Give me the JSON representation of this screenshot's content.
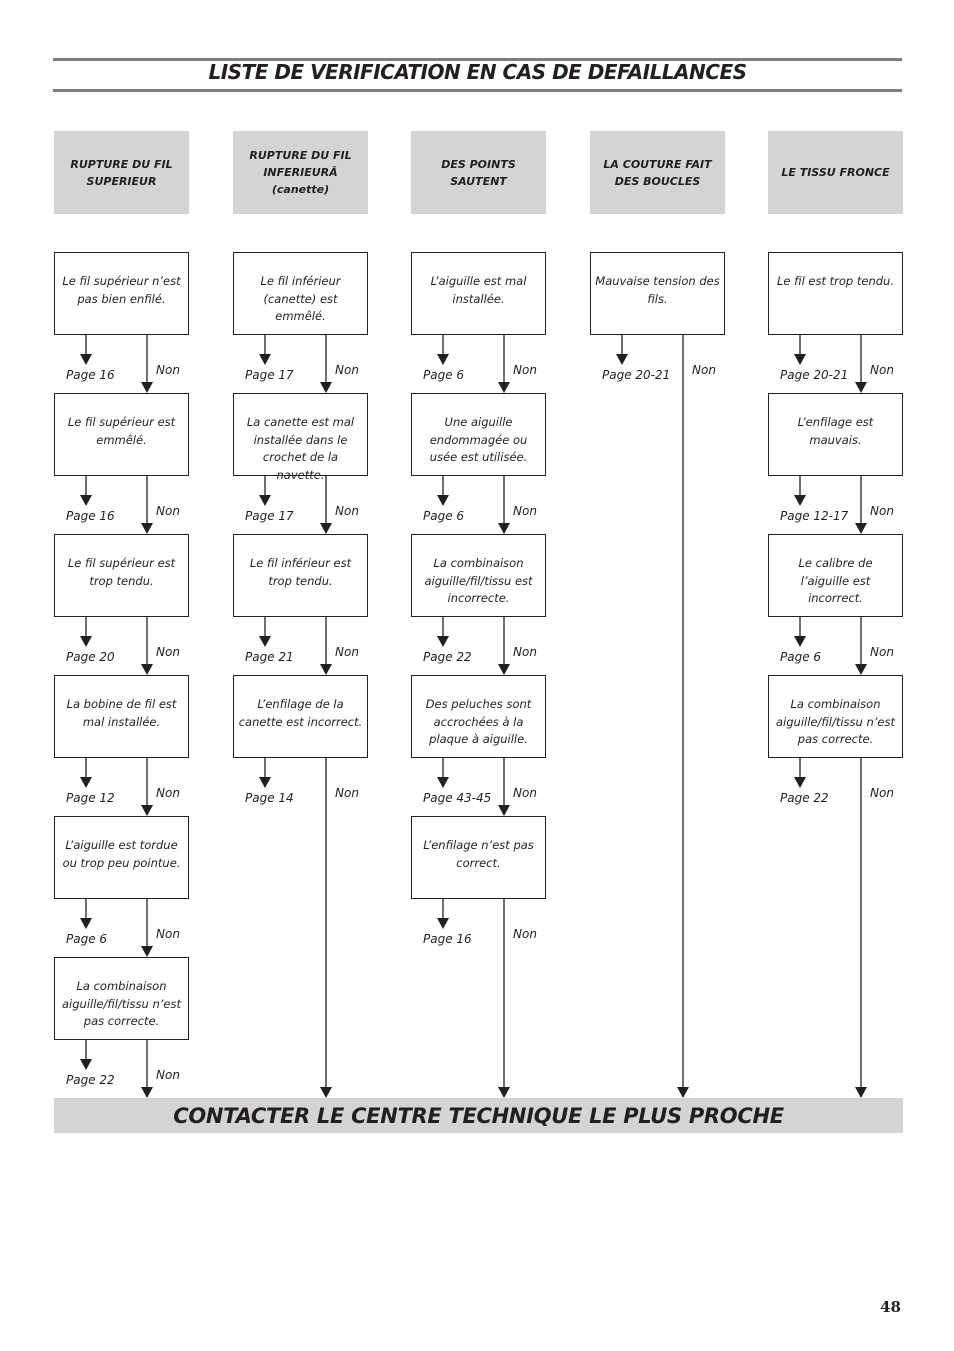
{
  "title": "LISTE DE VERIFICATION EN CAS DE DEFAILLANCES",
  "no_label": "Non",
  "columns": [
    {
      "header": "RUPTURE DU FIL SUPERIEUR",
      "steps": [
        {
          "text": "Le fil supérieur n’est pas bien enfilé.",
          "page": "Page 16"
        },
        {
          "text": "Le fil supérieur est emmêlé.",
          "page": "Page 16"
        },
        {
          "text": "Le fil supérieur est trop tendu.",
          "page": "Page 20"
        },
        {
          "text": "La bobine de fil est mal installée.",
          "page": "Page 12"
        },
        {
          "text": "L’aiguille est tordue ou trop peu pointue.",
          "page": "Page 6"
        },
        {
          "text": "La combinaison aiguille/fil/tissu n’est pas correcte.",
          "page": "Page 22"
        }
      ]
    },
    {
      "header": "RUPTURE DU FIL INFERIEURĂ (canette)",
      "steps": [
        {
          "text": "Le fil inférieur (canette) est emmêlé.",
          "page": "Page 17"
        },
        {
          "text": "La canette est mal installée dans le crochet de la navette.",
          "page": "Page 17"
        },
        {
          "text": "Le fil inférieur est trop tendu.",
          "page": "Page 21"
        },
        {
          "text": "L’enfilage de la canette est incorrect.",
          "page": "Page 14"
        }
      ]
    },
    {
      "header": "DES POINTS SAUTENT",
      "steps": [
        {
          "text": "L’aiguille est mal installée.",
          "page": "Page 6"
        },
        {
          "text": "Une aiguille endommagée ou usée est utilisée.",
          "page": "Page 6"
        },
        {
          "text": "La combinaison aiguille/fil/tissu est incorrecte.",
          "page": "Page 22"
        },
        {
          "text": "Des peluches sont accrochées à la plaque à aiguille.",
          "page": "Page 43-45"
        },
        {
          "text": "L’enfilage n’est pas correct.",
          "page": "Page 16"
        }
      ]
    },
    {
      "header": "LA COUTURE FAIT DES BOUCLES",
      "steps": [
        {
          "text": "Mauvaise tension des fils.",
          "page": "Page 20-21"
        }
      ]
    },
    {
      "header": "LE TISSU FRONCE",
      "steps": [
        {
          "text": "Le fil est trop tendu.",
          "page": "Page 20-21"
        },
        {
          "text": "L’enfilage est mauvais.",
          "page": "Page 12-17"
        },
        {
          "text": "Le calibre de l’aiguille est incorrect.",
          "page": "Page 6"
        },
        {
          "text": "La combinaison aiguille/fil/tissu n’est pas correcte.",
          "page": "Page 22"
        }
      ]
    }
  ],
  "contact": "CONTACTER LE CENTRE TECHNIQUE LE PLUS PROCHE",
  "page_number": "48"
}
